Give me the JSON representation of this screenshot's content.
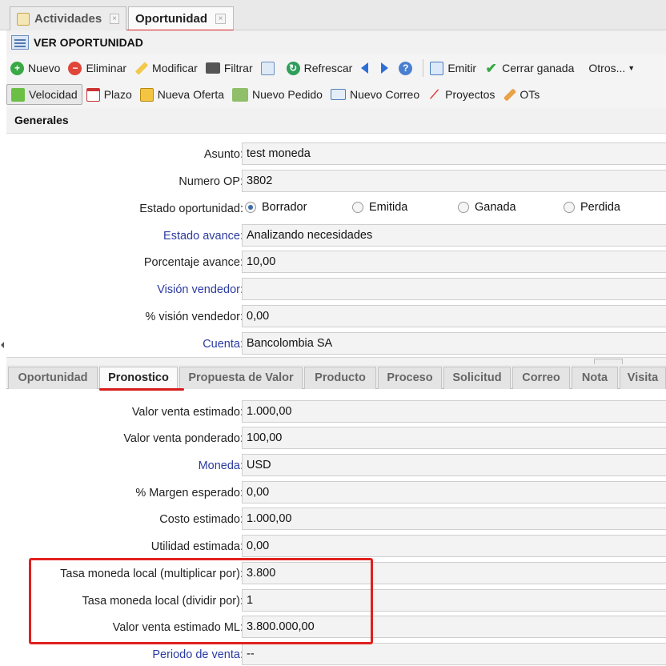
{
  "top_tabs": [
    {
      "label": "Actividades",
      "close": "×"
    },
    {
      "label": "Oportunidad",
      "close": "×"
    }
  ],
  "header": {
    "title": "VER OPORTUNIDAD"
  },
  "toolbar1": {
    "nuevo": "Nuevo",
    "eliminar": "Eliminar",
    "modificar": "Modificar",
    "filtrar": "Filtrar",
    "refrescar": "Refrescar",
    "emitir": "Emitir",
    "cerrar_ganada": "Cerrar ganada",
    "otros": "Otros..."
  },
  "toolbar2": {
    "velocidad": "Velocidad",
    "plazo": "Plazo",
    "nueva_oferta": "Nueva Oferta",
    "nuevo_pedido": "Nuevo Pedido",
    "nuevo_correo": "Nuevo Correo",
    "proyectos": "Proyectos",
    "ots": "OTs"
  },
  "section": {
    "title": "Generales"
  },
  "generales": {
    "asunto": {
      "label": "Asunto:",
      "value": "test moneda"
    },
    "numero_op": {
      "label": "Numero OP:",
      "value": "3802"
    },
    "estado_oportunidad": {
      "label": "Estado oportunidad:",
      "options": [
        "Borrador",
        "Emitida",
        "Ganada",
        "Perdida"
      ],
      "selected": "Borrador"
    },
    "estado_avance": {
      "label": "Estado avance:",
      "value": "Analizando necesidades"
    },
    "porcentaje_avance": {
      "label": "Porcentaje avance:",
      "value": "10,00"
    },
    "vision_vendedor": {
      "label": "Visión vendedor:",
      "value": ""
    },
    "pct_vision_vendedor": {
      "label": "% visión vendedor:",
      "value": "0,00"
    },
    "cuenta": {
      "label": "Cuenta:",
      "value": "Bancolombia SA"
    }
  },
  "lower_tabs": [
    "Oportunidad",
    "Pronostico",
    "Propuesta de Valor",
    "Producto",
    "Proceso",
    "Solicitud",
    "Correo",
    "Nota",
    "Visita"
  ],
  "pronostico": {
    "valor_venta_estimado": {
      "label": "Valor venta estimado:",
      "value": "1.000,00"
    },
    "valor_venta_ponderado": {
      "label": "Valor venta ponderado:",
      "value": "100,00"
    },
    "moneda": {
      "label": "Moneda:",
      "value": "USD"
    },
    "margen_esperado": {
      "label": "% Margen esperado:",
      "value": "0,00"
    },
    "costo_estimado": {
      "label": "Costo estimado:",
      "value": "1.000,00"
    },
    "utilidad_estimada": {
      "label": "Utilidad estimada:",
      "value": "0,00"
    },
    "tasa_multiplicar": {
      "label": "Tasa moneda local (multiplicar por):",
      "value": "3.800"
    },
    "tasa_dividir": {
      "label": "Tasa moneda local (dividir por):",
      "value": "1"
    },
    "valor_venta_ml": {
      "label": "Valor venta estimado ML:",
      "value": "3.800.000,00"
    },
    "periodo_venta": {
      "label": "Periodo de venta:",
      "value": "--"
    }
  },
  "colors": {
    "accent_red": "#d81b1b",
    "link_blue": "#2b3ba1"
  }
}
